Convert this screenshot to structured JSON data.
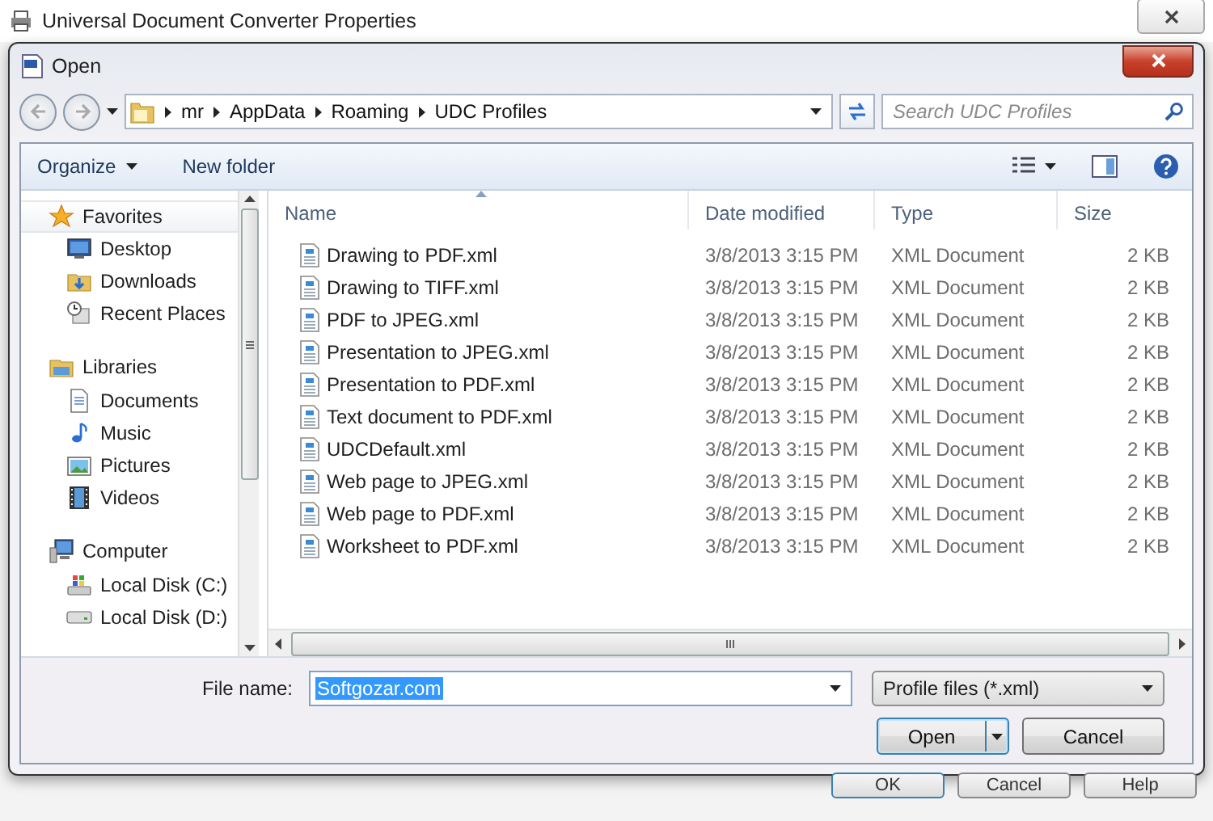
{
  "background_window": {
    "title": "Universal Document Converter Properties",
    "buttons": [
      "OK",
      "Cancel",
      "Help"
    ]
  },
  "dialog": {
    "title": "Open"
  },
  "address_bar": {
    "path": [
      "mr",
      "AppData",
      "Roaming",
      "UDC Profiles"
    ]
  },
  "search": {
    "placeholder": "Search UDC Profiles"
  },
  "toolbar": {
    "organize": "Organize",
    "new_folder": "New folder"
  },
  "sidebar": {
    "groups": [
      {
        "label": "Favorites",
        "kind": "favorites",
        "children": [
          {
            "label": "Desktop",
            "kind": "desktop"
          },
          {
            "label": "Downloads",
            "kind": "downloads"
          },
          {
            "label": "Recent Places",
            "kind": "recent"
          }
        ]
      },
      {
        "label": "Libraries",
        "kind": "libraries",
        "children": [
          {
            "label": "Documents",
            "kind": "documents"
          },
          {
            "label": "Music",
            "kind": "music"
          },
          {
            "label": "Pictures",
            "kind": "pictures"
          },
          {
            "label": "Videos",
            "kind": "videos"
          }
        ]
      },
      {
        "label": "Computer",
        "kind": "computer",
        "children": [
          {
            "label": "Local Disk (C:)",
            "kind": "systemdisk"
          },
          {
            "label": "Local Disk (D:)",
            "kind": "disk"
          }
        ]
      }
    ]
  },
  "table": {
    "columns": [
      "Name",
      "Date modified",
      "Type",
      "Size"
    ],
    "rows": [
      {
        "name": "Drawing to PDF.xml",
        "date": "3/8/2013 3:15 PM",
        "type": "XML Document",
        "size": "2 KB"
      },
      {
        "name": "Drawing to TIFF.xml",
        "date": "3/8/2013 3:15 PM",
        "type": "XML Document",
        "size": "2 KB"
      },
      {
        "name": "PDF to JPEG.xml",
        "date": "3/8/2013 3:15 PM",
        "type": "XML Document",
        "size": "2 KB"
      },
      {
        "name": "Presentation to JPEG.xml",
        "date": "3/8/2013 3:15 PM",
        "type": "XML Document",
        "size": "2 KB"
      },
      {
        "name": "Presentation to PDF.xml",
        "date": "3/8/2013 3:15 PM",
        "type": "XML Document",
        "size": "2 KB"
      },
      {
        "name": "Text document to PDF.xml",
        "date": "3/8/2013 3:15 PM",
        "type": "XML Document",
        "size": "2 KB"
      },
      {
        "name": "UDCDefault.xml",
        "date": "3/8/2013 3:15 PM",
        "type": "XML Document",
        "size": "2 KB"
      },
      {
        "name": "Web page to JPEG.xml",
        "date": "3/8/2013 3:15 PM",
        "type": "XML Document",
        "size": "2 KB"
      },
      {
        "name": "Web page to PDF.xml",
        "date": "3/8/2013 3:15 PM",
        "type": "XML Document",
        "size": "2 KB"
      },
      {
        "name": "Worksheet to PDF.xml",
        "date": "3/8/2013 3:15 PM",
        "type": "XML Document",
        "size": "2 KB"
      }
    ]
  },
  "file_name": {
    "label": "File name:",
    "value": "Softgozar.com",
    "selected": true
  },
  "file_type": {
    "value": "Profile files (*.xml)"
  },
  "buttons": [
    {
      "label": "Open",
      "kind": "split"
    },
    {
      "label": "Cancel",
      "kind": "plain"
    }
  ]
}
